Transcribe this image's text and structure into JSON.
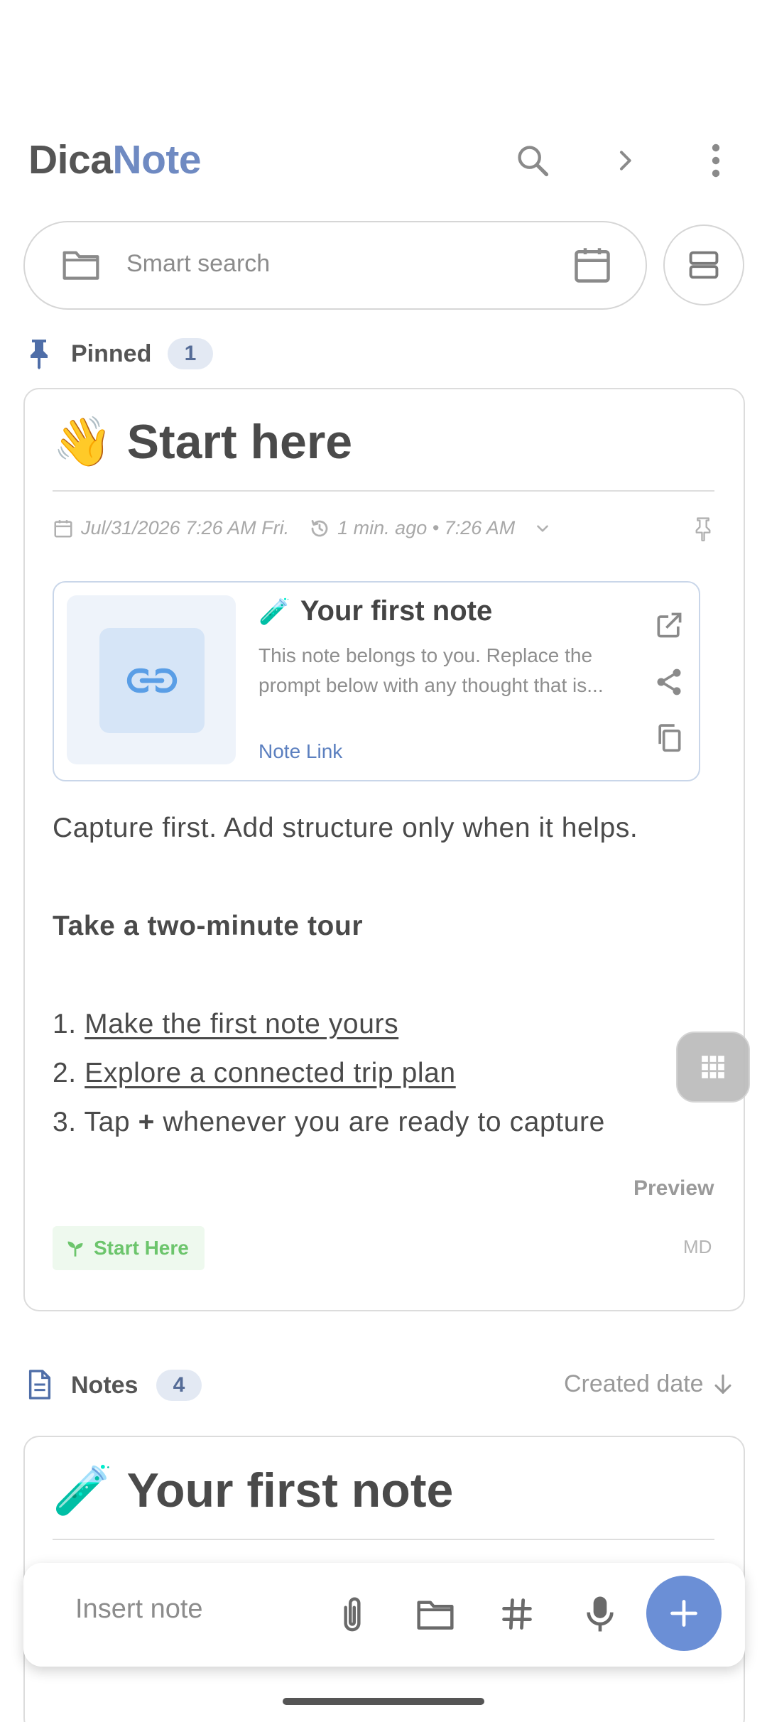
{
  "header": {
    "logo_part1": "Dica",
    "logo_part2": "Note",
    "icons": [
      "search-icon",
      "chevron-right-icon",
      "more-vert-icon"
    ]
  },
  "search": {
    "placeholder": "Smart search",
    "left_icon": "folder-icon",
    "right_icon": "calendar-icon",
    "view_toggle_icon": "view-agenda-icon"
  },
  "pinned": {
    "label": "Pinned",
    "count": "1",
    "note": {
      "emoji": "👋",
      "title": "Start here",
      "date": "Jul/31/2026 7:26 AM Fri.",
      "updated": "1 min. ago • 7:26 AM",
      "link_preview": {
        "emoji": "🧪",
        "title": "Your first note",
        "desc_line1": "This note belongs to you. Replace the",
        "desc_line2": "prompt below with any thought that is...",
        "link_label": "Note Link"
      },
      "body_intro": "Capture first. Add structure only when it helps.",
      "body_heading": "Take a two-minute tour",
      "list": [
        {
          "num": "1.",
          "text": "Make the first note yours"
        },
        {
          "num": "2.",
          "text": "Explore a connected trip plan"
        },
        {
          "num": "3.",
          "pre": "Tap ",
          "bold": "+",
          "post": " whenever you are ready to capture"
        }
      ],
      "preview_label": "Preview",
      "tag": "Start Here",
      "format": "MD"
    }
  },
  "notes": {
    "label": "Notes",
    "count": "4",
    "sort_label": "Created date",
    "first_note": {
      "emoji": "🧪",
      "title": "Your first note"
    }
  },
  "bottom_bar": {
    "placeholder": "Insert note",
    "icons": [
      "attach-icon",
      "folder-icon",
      "hashtag-icon",
      "mic-icon",
      "add-icon"
    ]
  },
  "colors": {
    "accent": "#6b8fd6",
    "logo_accent": "#6f8ac2",
    "tag_green": "#6cc56c"
  }
}
